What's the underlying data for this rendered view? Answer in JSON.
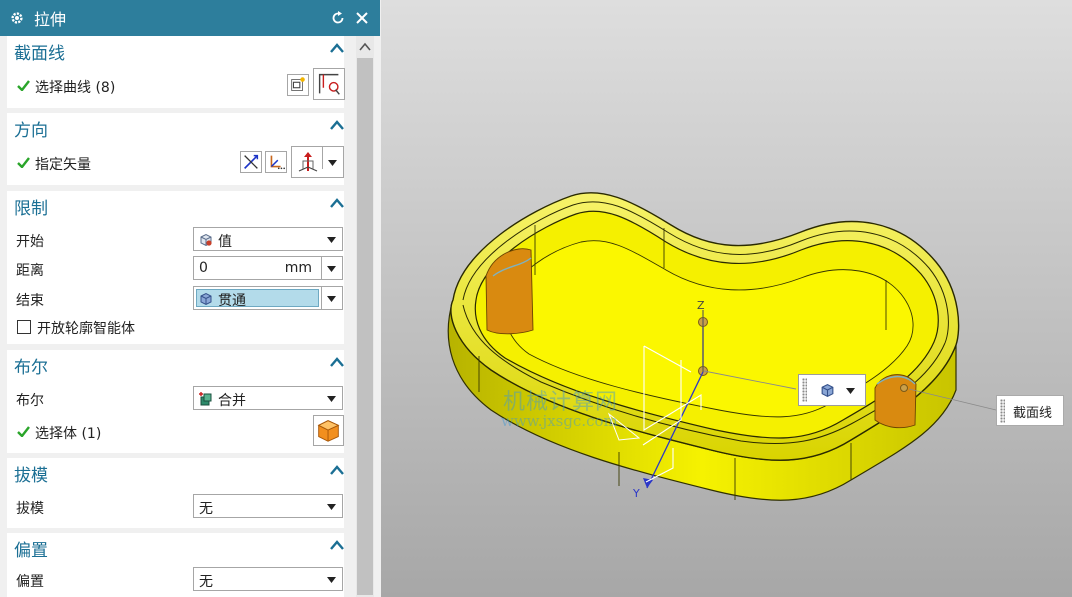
{
  "dialog": {
    "title": "拉伸",
    "icons": {
      "settings": "gear-icon",
      "reset": "reset-icon",
      "close": "close-icon"
    }
  },
  "sections": {
    "section_curve": {
      "title": "截面线",
      "select_curve_label": "选择曲线 (8)"
    },
    "direction": {
      "title": "方向",
      "vector_label": "指定矢量"
    },
    "limits": {
      "title": "限制",
      "start_label": "开始",
      "start_value": "值",
      "distance_label": "距离",
      "distance_value": "0",
      "distance_unit": "mm",
      "end_label": "结束",
      "end_value": "贯通",
      "open_profile_label": "开放轮廓智能体"
    },
    "boolean": {
      "title": "布尔",
      "boolean_label": "布尔",
      "boolean_value": "合并",
      "select_body_label": "选择体 (1)"
    },
    "draft": {
      "title": "拔模",
      "draft_label": "拔模",
      "draft_value": "无"
    },
    "offset": {
      "title": "偏置",
      "offset_label": "偏置",
      "offset_value": "无"
    }
  },
  "viewport": {
    "section_tag": "截面线",
    "axis_z": "Z",
    "axis_y": "Y",
    "watermark_line1": "机械计算网",
    "watermark_line2": "www.jxsgc.com"
  },
  "colors": {
    "titlebar": "#2d7e9c",
    "section_title": "#1b6f94",
    "check": "#2aa52a",
    "part": "#f3f000"
  }
}
